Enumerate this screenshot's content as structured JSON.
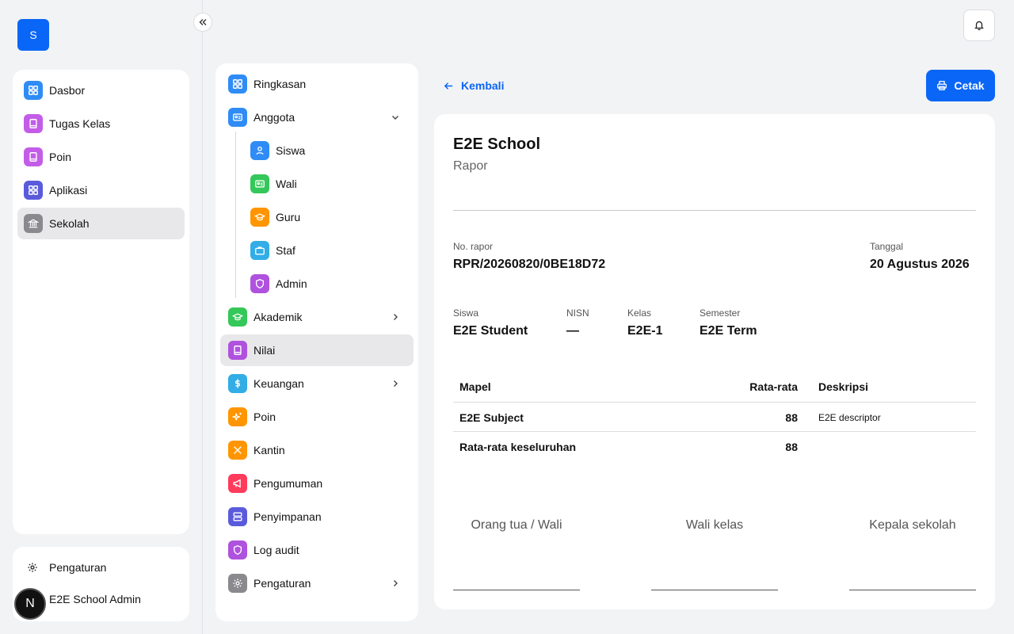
{
  "app": {
    "logo_letter": "S",
    "user_name": "E2E School Admin",
    "user_initial": "N",
    "settings_label": "Pengaturan"
  },
  "sidebar": {
    "items": [
      {
        "label": "Dasbor",
        "icon": "grid-icon",
        "color": "#2f8cf6"
      },
      {
        "label": "Tugas Kelas",
        "icon": "book-icon",
        "color": "#c35de8"
      },
      {
        "label": "Poin",
        "icon": "book-icon",
        "color": "#c35de8"
      },
      {
        "label": "Aplikasi",
        "icon": "grid-icon",
        "color": "#5a5bdc"
      },
      {
        "label": "Sekolah",
        "icon": "bank-icon",
        "color": "#8a8a8e"
      }
    ]
  },
  "subnav": {
    "items": [
      {
        "label": "Ringkasan",
        "icon": "grid-icon",
        "color": "#2f8cf6"
      },
      {
        "label": "Anggota",
        "icon": "id-card-icon",
        "color": "#2f8cf6"
      },
      {
        "label": "Siswa",
        "icon": "user-icon",
        "color": "#2f8cf6"
      },
      {
        "label": "Wali",
        "icon": "id-card-icon",
        "color": "#34c759"
      },
      {
        "label": "Guru",
        "icon": "graduation-cap-icon",
        "color": "#ff9500"
      },
      {
        "label": "Staf",
        "icon": "briefcase-icon",
        "color": "#32ade6"
      },
      {
        "label": "Admin",
        "icon": "shield-icon",
        "color": "#af52de"
      },
      {
        "label": "Akademik",
        "icon": "graduation-cap-icon",
        "color": "#34c759"
      },
      {
        "label": "Nilai",
        "icon": "book-icon",
        "color": "#af52de"
      },
      {
        "label": "Keuangan",
        "icon": "dollar-icon",
        "color": "#32ade6"
      },
      {
        "label": "Poin",
        "icon": "sparkles-icon",
        "color": "#ff9500"
      },
      {
        "label": "Kantin",
        "icon": "utensils-icon",
        "color": "#ff9500"
      },
      {
        "label": "Pengumuman",
        "icon": "megaphone-icon",
        "color": "#ff3b5c"
      },
      {
        "label": "Penyimpanan",
        "icon": "server-icon",
        "color": "#5a5bdc"
      },
      {
        "label": "Log audit",
        "icon": "shield-icon",
        "color": "#af52de"
      },
      {
        "label": "Pengaturan",
        "icon": "gear-icon",
        "color": "#8a8a8e"
      }
    ]
  },
  "topbar": {
    "back_label": "Kembali",
    "print_label": "Cetak"
  },
  "report": {
    "school_name": "E2E School",
    "doc_type": "Rapor",
    "number_label": "No. rapor",
    "number_value": "RPR/20260820/0BE18D72",
    "date_label": "Tanggal",
    "date_value": "20 Agustus 2026",
    "student_label": "Siswa",
    "student_value": "E2E Student",
    "nisn_label": "NISN",
    "nisn_value": "—",
    "class_label": "Kelas",
    "class_value": "E2E-1",
    "semester_label": "Semester",
    "semester_value": "E2E Term",
    "table": {
      "headers": [
        "Mapel",
        "Rata-rata",
        "Deskripsi"
      ],
      "rows": [
        [
          "E2E Subject",
          "88",
          "E2E descriptor"
        ],
        [
          "Rata-rata keseluruhan",
          "88",
          ""
        ]
      ]
    },
    "signatures": [
      "Orang tua / Wali",
      "Wali kelas",
      "Kepala sekolah"
    ]
  },
  "colors": {
    "accent": "#0a66f6",
    "active_bg": "#e8e8ea",
    "page_bg": "#f2f3f5"
  }
}
